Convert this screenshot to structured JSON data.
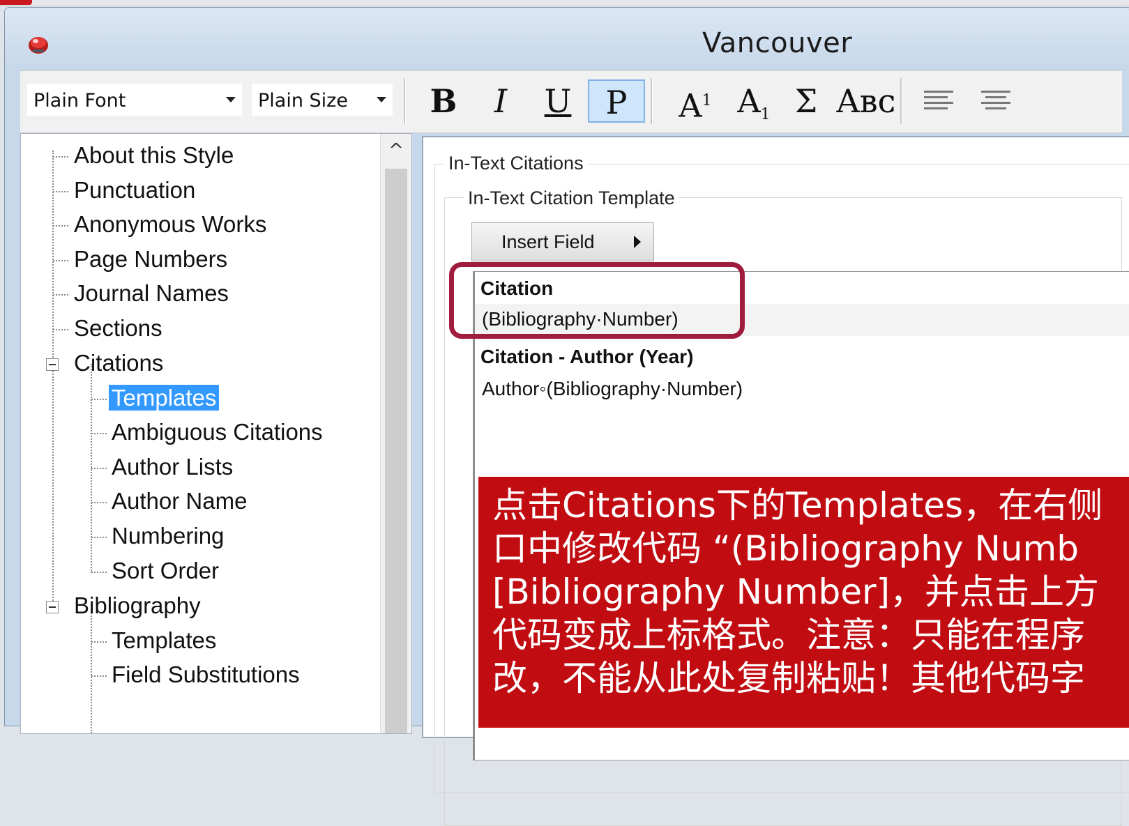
{
  "window": {
    "title": "Vancouver",
    "app_icon": "endnote-app-icon"
  },
  "toolbar": {
    "font_value": "Plain Font",
    "size_value": "Plain Size",
    "bold": "B",
    "italic": "I",
    "underline": "U",
    "plain": "P",
    "superscript_base": "A",
    "superscript_mark": "1",
    "subscript_base": "A",
    "subscript_mark": "1",
    "symbol": "Σ",
    "smallcaps": "Aʙᴄ",
    "active_button": "plain"
  },
  "tree": {
    "items": [
      {
        "label": "About this Style",
        "level": 0
      },
      {
        "label": "Punctuation",
        "level": 0
      },
      {
        "label": "Anonymous Works",
        "level": 0
      },
      {
        "label": "Page Numbers",
        "level": 0
      },
      {
        "label": "Journal Names",
        "level": 0
      },
      {
        "label": "Sections",
        "level": 0
      },
      {
        "label": "Citations",
        "level": 0,
        "expanded": true
      },
      {
        "label": "Templates",
        "level": 1,
        "selected": true
      },
      {
        "label": "Ambiguous Citations",
        "level": 1
      },
      {
        "label": "Author Lists",
        "level": 1
      },
      {
        "label": "Author Name",
        "level": 1
      },
      {
        "label": "Numbering",
        "level": 1
      },
      {
        "label": "Sort Order",
        "level": 1
      },
      {
        "label": "Bibliography",
        "level": 0,
        "expanded": true
      },
      {
        "label": "Templates",
        "level": 1
      },
      {
        "label": "Field Substitutions",
        "level": 1
      }
    ]
  },
  "editor": {
    "group_title": "In-Text Citations",
    "subgroup_title": "In-Text Citation Template",
    "insert_field_label": "Insert Field",
    "citation_heading": "Citation",
    "citation_template": "(Bibliography·Number)",
    "author_year_heading": "Citation - Author (Year)",
    "author_year_template": "Author◦(Bibliography·Number)"
  },
  "note": {
    "lines": [
      "点击Citations下的Templates，在右侧",
      "口中修改代码 “(Bibliography Numb",
      "[Bibliography Number]，并点击上方",
      "代码变成上标格式。注意：只能在程序",
      "改，不能从此处复制粘贴！其他代码字"
    ]
  },
  "colors": {
    "selection": "#3399ff",
    "note_bg": "#c10d12",
    "highlight_border": "#a01c3c"
  }
}
